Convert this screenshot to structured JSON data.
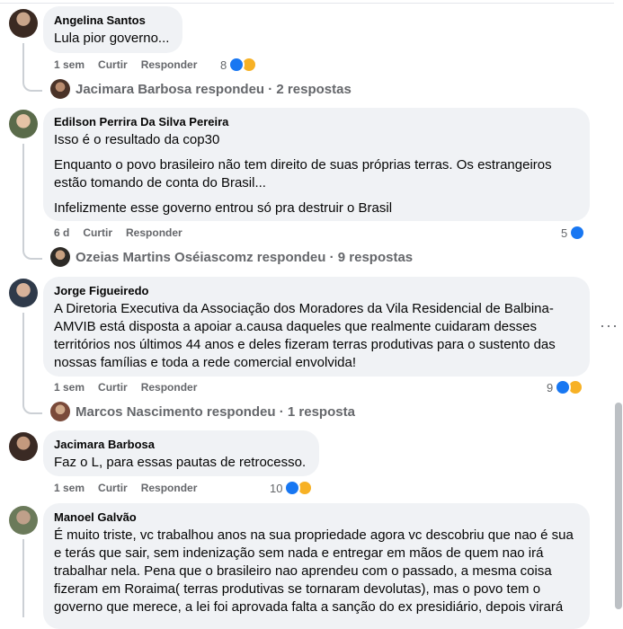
{
  "comments": [
    {
      "author": "Angelina Santos",
      "paragraphs": [
        "Lula pior governo..."
      ],
      "time": "1 sem",
      "curtir": "Curtir",
      "responder": "Responder",
      "reaction_count": "8",
      "reaction_icons": [
        "like-icon",
        "haha-icon"
      ],
      "replies_text": "Jacimara Barbosa respondeu · 2 respostas"
    },
    {
      "author": "Edilson Perrira Da Silva Pereira",
      "paragraphs": [
        "Isso é o resultado da cop30",
        "Enquanto o povo brasileiro não tem direito de suas próprias terras. Os estrangeiros estão tomando de conta do Brasil...",
        "Infelizmente esse governo entrou só pra destruir o Brasil"
      ],
      "time": "6 d",
      "curtir": "Curtir",
      "responder": "Responder",
      "reaction_count": "5",
      "reaction_icons": [
        "like-icon"
      ],
      "replies_text": "Ozeias Martins Oséiascomz respondeu · 9 respostas"
    },
    {
      "author": "Jorge Figueiredo",
      "paragraphs": [
        "A Diretoria Executiva da Associação dos Moradores da Vila Residencial de Balbina-AMVIB está disposta a apoiar a.causa daqueles que realmente cuidaram desses territórios nos últimos 44 anos e deles fizeram terras produtivas para o sustento das nossas famílias e toda a rede comercial envolvida!"
      ],
      "time": "1 sem",
      "curtir": "Curtir",
      "responder": "Responder",
      "reaction_count": "9",
      "reaction_icons": [
        "like-icon",
        "haha-icon"
      ],
      "replies_text": "Marcos Nascimento respondeu · 1 resposta"
    },
    {
      "author": "Jacimara Barbosa",
      "paragraphs": [
        "Faz o L, para essas pautas de retrocesso."
      ],
      "time": "1 sem",
      "curtir": "Curtir",
      "responder": "Responder",
      "reaction_count": "10",
      "reaction_icons": [
        "like-icon",
        "haha-icon"
      ]
    },
    {
      "author": "Manoel Galvão",
      "paragraphs": [
        "É muito triste, vc trabalhou anos na sua propriedade agora vc descobriu que nao é sua e terás que sair, sem indenização sem nada e entregar em mãos de quem nao irá trabalhar nela. Pena que o brasileiro nao aprendeu com o passado, a mesma coisa fizeram em Roraima( terras produtivas se tornaram devolutas), mas o povo tem o governo que merece, a lei foi aprovada falta a sanção do ex presidiário, depois virará"
      ]
    }
  ],
  "more_options": "···",
  "colors": {
    "bubble": "#f0f2f5",
    "like": "#1877f2",
    "haha": "#f7b125",
    "secondary": "#65676b"
  }
}
